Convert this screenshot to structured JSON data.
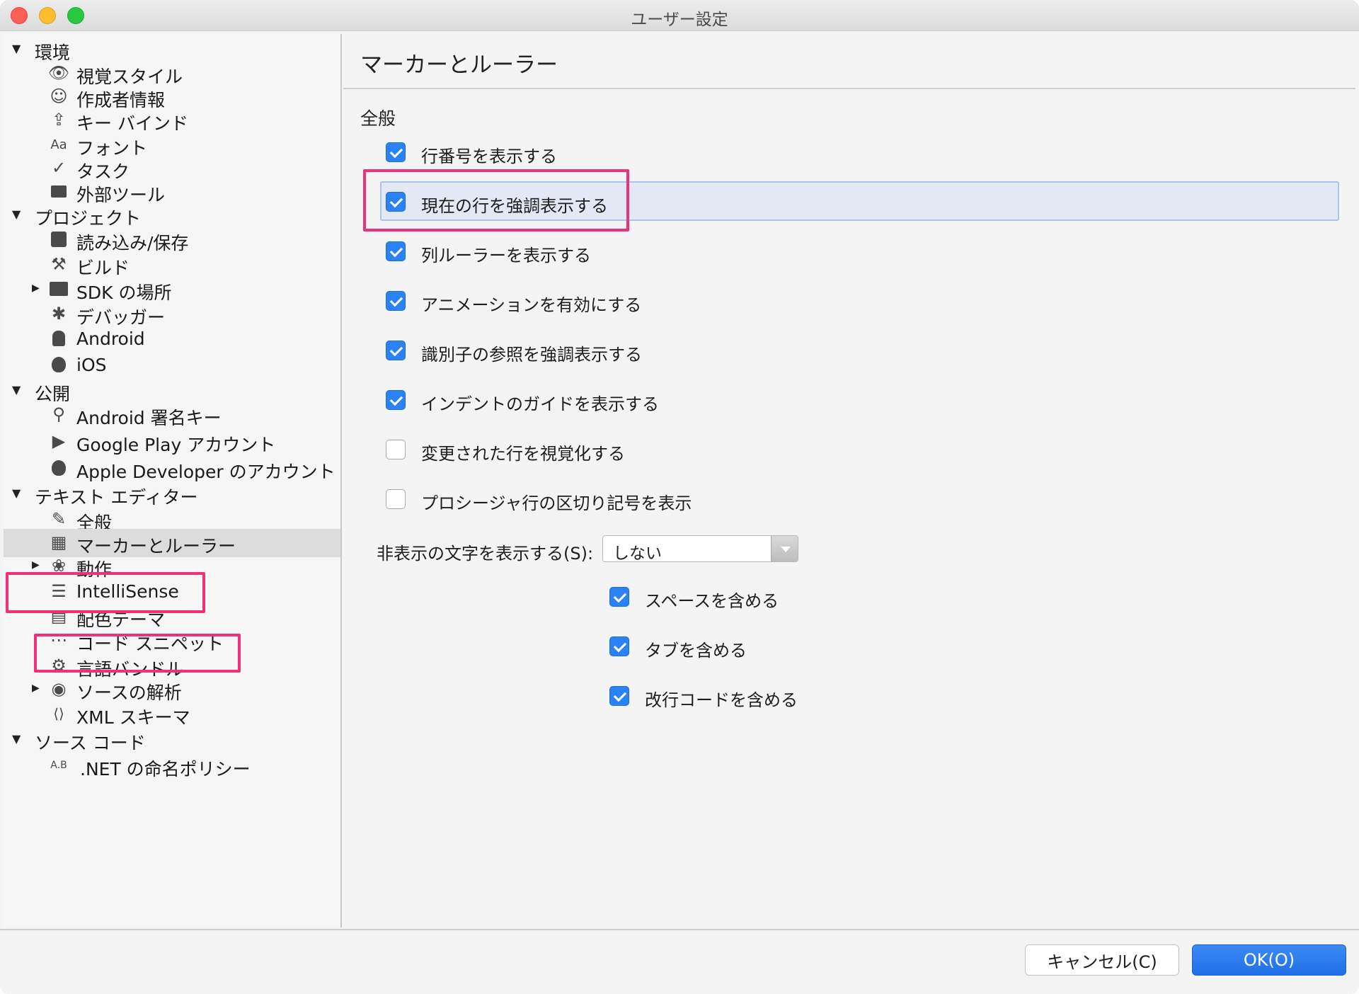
{
  "window": {
    "title": "ユーザー設定"
  },
  "sidebar": {
    "groups": [
      {
        "label": "環境",
        "items": [
          "視覚スタイル",
          "作成者情報",
          "キー バインド",
          "フォント",
          "タスク",
          "外部ツール"
        ]
      },
      {
        "label": "プロジェクト",
        "items": [
          "読み込み/保存",
          "ビルド",
          "SDK の場所",
          "デバッガー",
          "Android",
          "iOS"
        ]
      },
      {
        "label": "公開",
        "items": [
          "Android 署名キー",
          "Google Play アカウント",
          "Apple Developer のアカウント"
        ]
      },
      {
        "label": "テキスト エディター",
        "items": [
          "全般",
          "マーカーとルーラー",
          "動作",
          "IntelliSense",
          "配色テーマ",
          "コード スニペット",
          "言語バンドル",
          "ソースの解析",
          "XML スキーマ"
        ]
      },
      {
        "label": "ソース コード",
        "items": [
          ".NET の命名ポリシー"
        ]
      }
    ],
    "icons": {
      "visual": "eye-icon",
      "author": "smiley-icon",
      "keybind": "keyboard-icon",
      "font": "font-icon",
      "task": "checkmark-icon",
      "tools": "terminal-icon",
      "loadsave": "disk-icon",
      "build": "hammer-icon",
      "sdk": "folder-icon",
      "debugger": "bug-icon",
      "android": "android-icon",
      "ios": "apple-icon",
      "signkey": "key-icon",
      "googleplay": "play-icon",
      "apple": "apple-icon",
      "general": "pencil-icon",
      "markers": "grid-icon",
      "behavior": "brain-icon",
      "intellisense": "list-icon",
      "color": "document-icon",
      "snippets": "snippet-icon",
      "bundles": "gear-icon",
      "source": "target-icon",
      "xml": "xml-icon",
      "naming": "naming-icon"
    }
  },
  "content": {
    "page_title": "マーカーとルーラー",
    "section_title": "全般",
    "options": [
      {
        "label": "行番号を表示する",
        "checked": true
      },
      {
        "label": "現在の行を強調表示する",
        "checked": true
      },
      {
        "label": "列ルーラーを表示する",
        "checked": true
      },
      {
        "label": "アニメーションを有効にする",
        "checked": true
      },
      {
        "label": "識別子の参照を強調表示する",
        "checked": true
      },
      {
        "label": "インデントのガイドを表示する",
        "checked": true
      },
      {
        "label": "変更された行を視覚化する",
        "checked": false
      },
      {
        "label": "プロシージャ行の区切り記号を表示",
        "checked": false
      }
    ],
    "whitespace_label": "非表示の文字を表示する(S):",
    "whitespace_value": "しない",
    "sub_options": [
      {
        "label": "スペースを含める",
        "checked": true
      },
      {
        "label": "タブを含める",
        "checked": true
      },
      {
        "label": "改行コードを含める",
        "checked": true
      }
    ]
  },
  "footer": {
    "cancel_label": "キャンセル(C)",
    "ok_label": "OK(O)"
  },
  "colors": {
    "accent": "#2a82f4",
    "highlight": "#f0307a",
    "selected_row": "#dcdcdc"
  }
}
